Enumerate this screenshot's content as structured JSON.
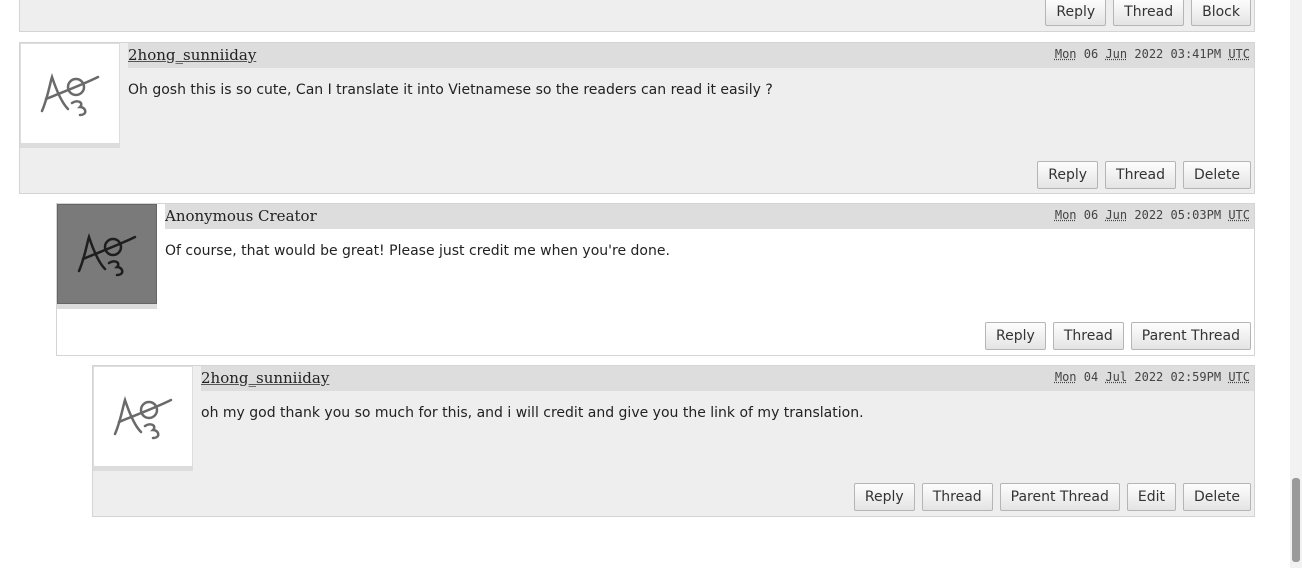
{
  "top_comment": {
    "buttons": [
      "Reply",
      "Thread",
      "Block"
    ]
  },
  "comments": [
    {
      "username": "2hong_sunniiday",
      "timestamp": {
        "day": "Mon",
        "date": "06",
        "month": "Jun",
        "year_time": "2022 03:41PM",
        "tz": "UTC"
      },
      "body": "Oh gosh this is so cute, Can I translate it into Vietnamese so the readers can read it easily ?",
      "buttons": [
        "Reply",
        "Thread",
        "Delete"
      ]
    },
    {
      "username": "Anonymous Creator",
      "timestamp": {
        "day": "Mon",
        "date": "06",
        "month": "Jun",
        "year_time": "2022 05:03PM",
        "tz": "UTC"
      },
      "body": "Of course, that would be great! Please just credit me when you're done.",
      "buttons": [
        "Reply",
        "Thread",
        "Parent Thread"
      ]
    },
    {
      "username": "2hong_sunniiday",
      "timestamp": {
        "day": "Mon",
        "date": "04",
        "month": "Jul",
        "year_time": "2022 02:59PM",
        "tz": "UTC"
      },
      "body": "oh my god thank you so much for this, and i will credit and give you the link of my translation.",
      "buttons": [
        "Reply",
        "Thread",
        "Parent Thread",
        "Edit",
        "Delete"
      ]
    }
  ],
  "icons": {
    "avatar": "ao3-default-avatar-icon"
  },
  "colors": {
    "comment_bg": "#eeeeee",
    "header_bg": "#dddddd",
    "creator_avatar_bg": "#7a7a7a"
  }
}
